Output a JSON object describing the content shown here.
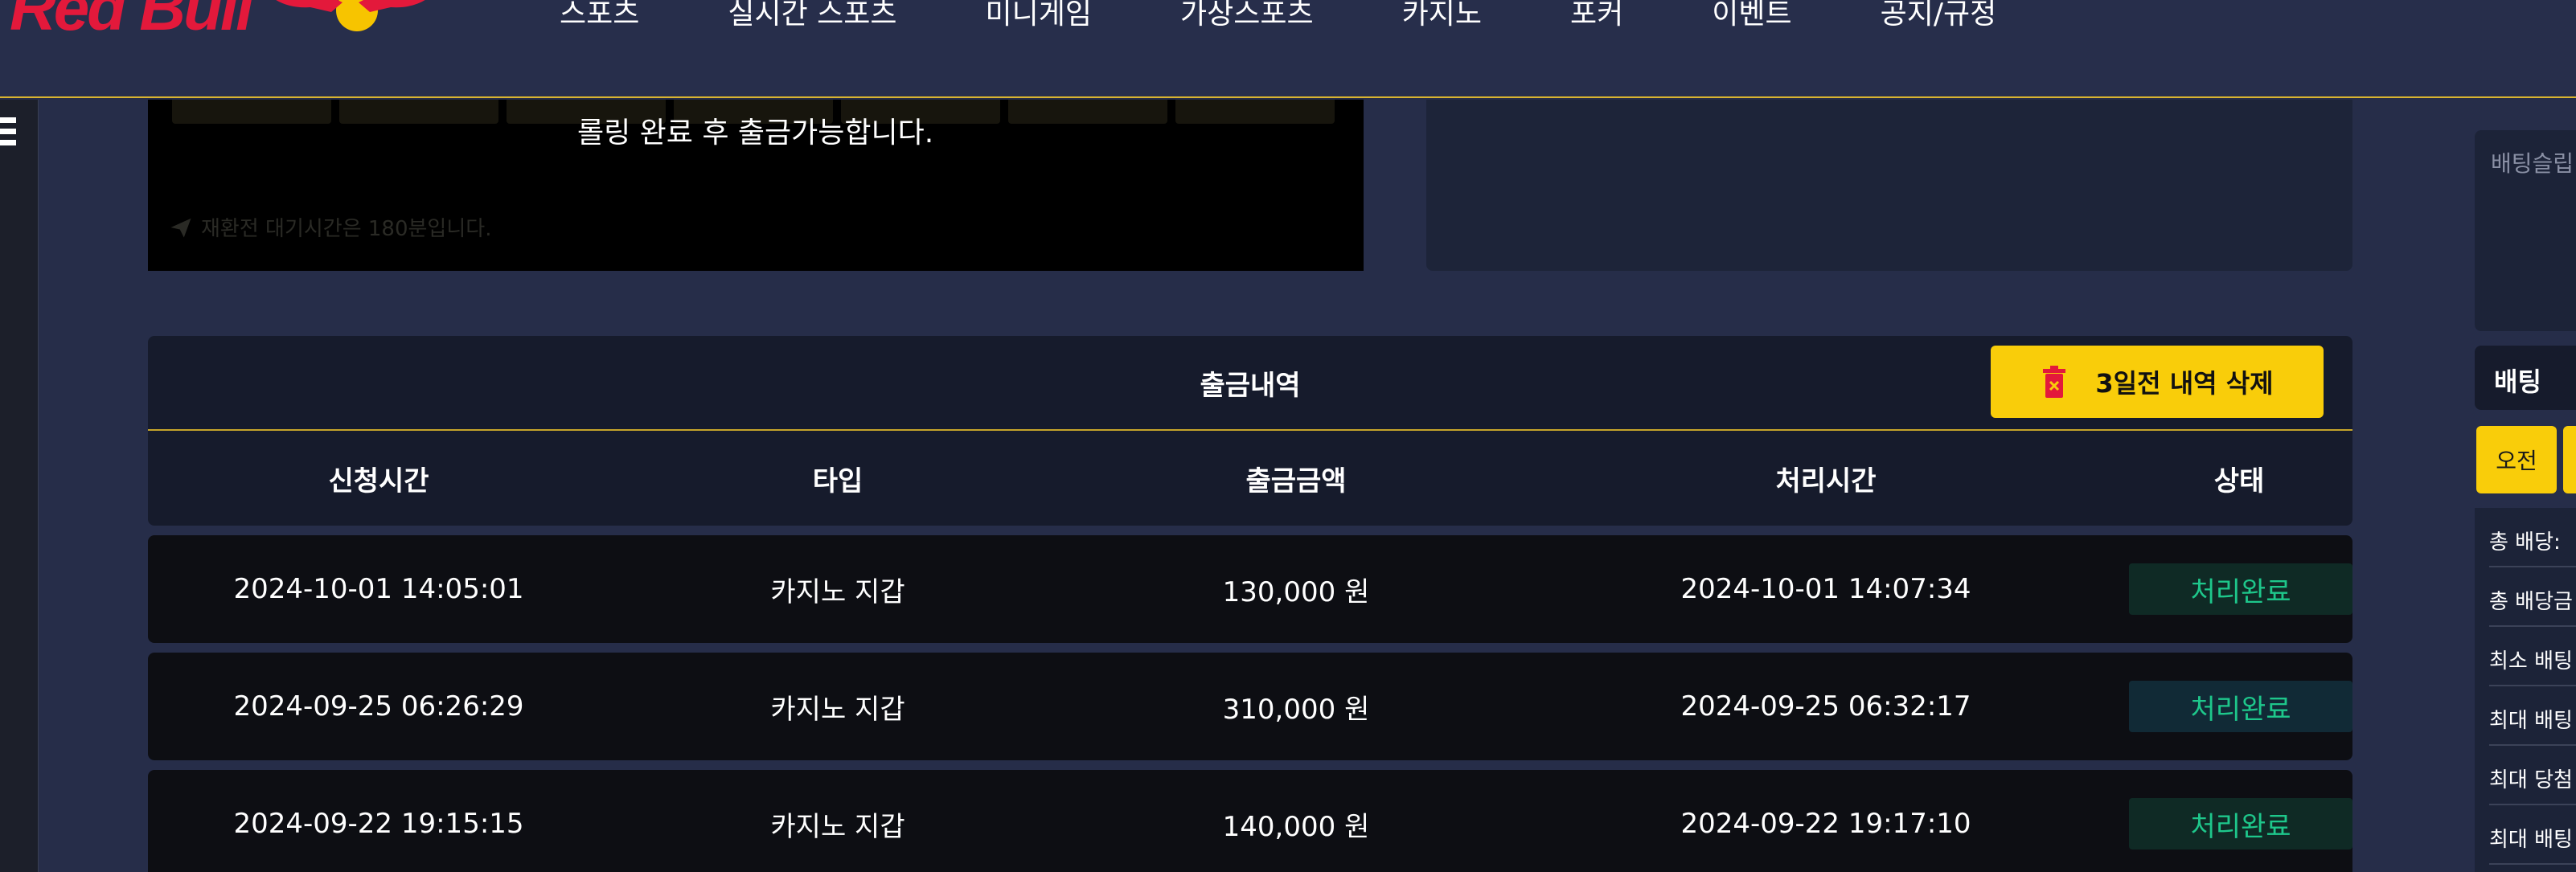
{
  "brand": {
    "name": "Red Bull"
  },
  "nav": {
    "items": [
      "스포츠",
      "실시간 스포츠",
      "미니게임",
      "가상스포츠",
      "카지노",
      "포커",
      "이벤트",
      "공지/규정"
    ]
  },
  "notice": {
    "message": "롤링 완료 후 출금가능합니다.",
    "sub_message": "재환전 대기시간은 180분입니다."
  },
  "withdrawal": {
    "title": "출금내역",
    "delete_button": "3일전 내역 삭제",
    "columns": [
      "신청시간",
      "타입",
      "출금금액",
      "처리시간",
      "상태"
    ],
    "rows": [
      {
        "requested": "2024-10-01 14:05:01",
        "type": "카지노 지갑",
        "amount": "130,000 원",
        "processed": "2024-10-01 14:07:34",
        "status": "처리완료"
      },
      {
        "requested": "2024-09-25 06:26:29",
        "type": "카지노 지갑",
        "amount": "310,000 원",
        "processed": "2024-09-25 06:32:17",
        "status": "처리완료"
      },
      {
        "requested": "2024-09-22 19:15:15",
        "type": "카지노 지갑",
        "amount": "140,000 원",
        "processed": "2024-09-22 19:17:10",
        "status": "처리완료"
      }
    ]
  },
  "bet_slip": {
    "placeholder": "배팅슬립",
    "header": "배팅",
    "button": "오전",
    "stats": [
      "총 배당:",
      "총 배당금",
      "최소 배팅",
      "최대 배팅",
      "최대 당첨",
      "최대 배팅"
    ]
  },
  "colors": {
    "accent": "#f9cd0a",
    "status_success": "#1ec78b",
    "brand_red": "#e3193b"
  }
}
